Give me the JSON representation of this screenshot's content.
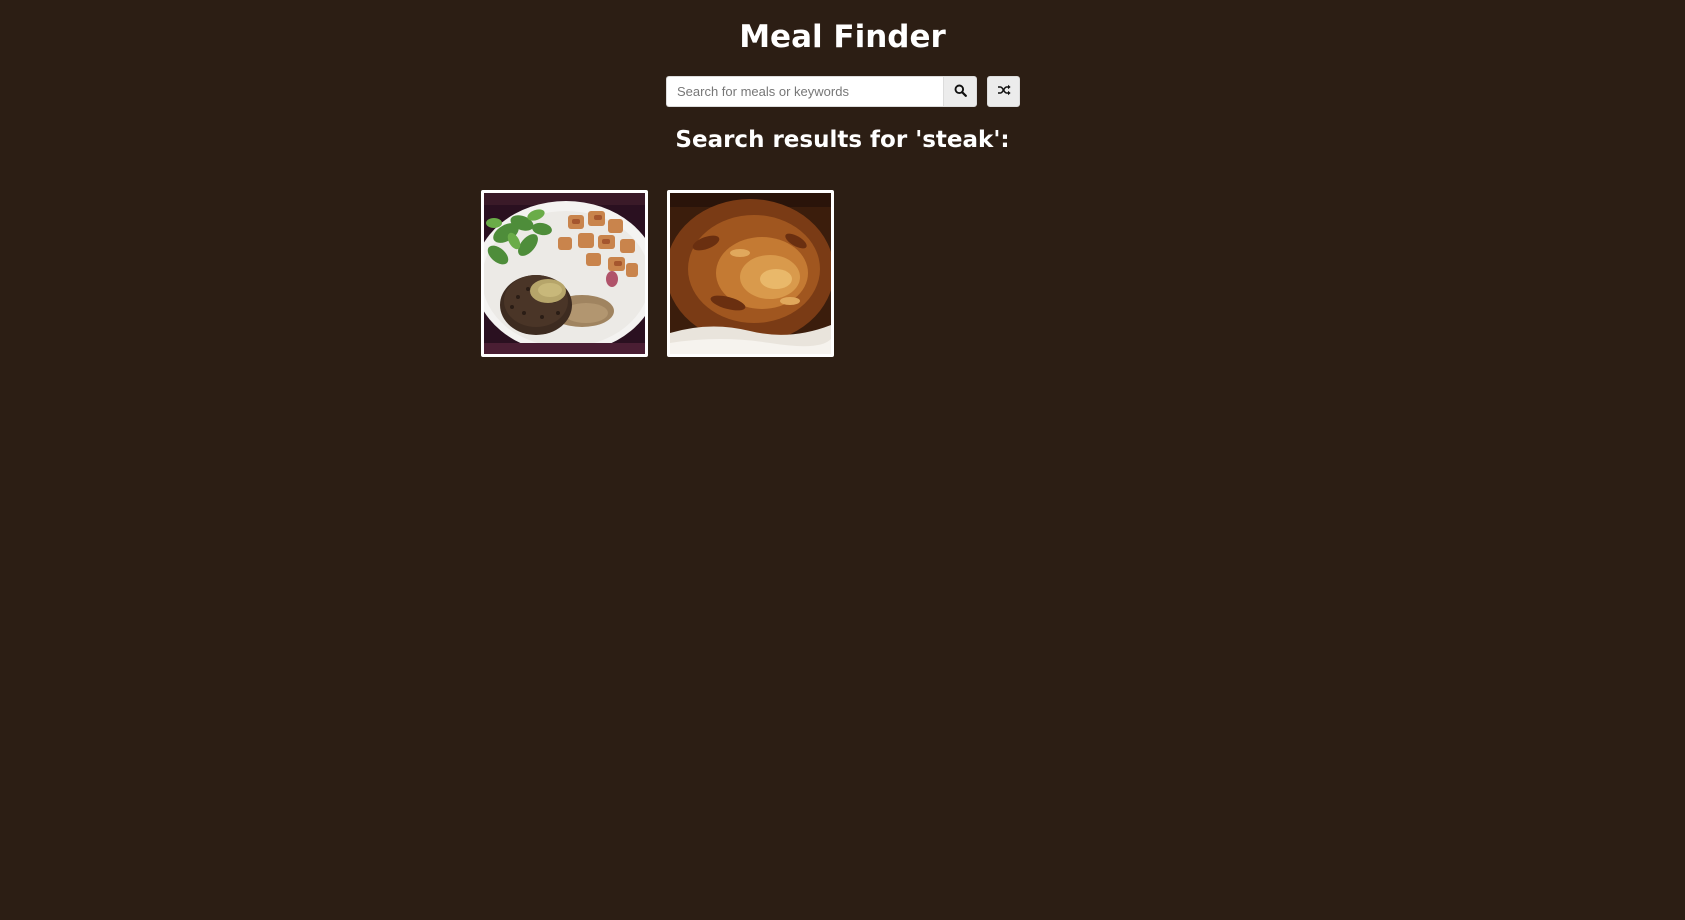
{
  "app": {
    "title": "Meal Finder"
  },
  "search": {
    "placeholder": "Search for meals or keywords",
    "value": "",
    "search_icon": "search-icon",
    "random_icon": "shuffle-icon"
  },
  "results": {
    "heading": "Search results for 'steak':",
    "meals": [
      {
        "image": "steak-with-pepper-sauce-salad-and-potatoes"
      },
      {
        "image": "steak-pie"
      }
    ]
  },
  "colors": {
    "background": "#2c1e14",
    "text": "#ffffff",
    "button": "#ececec"
  }
}
